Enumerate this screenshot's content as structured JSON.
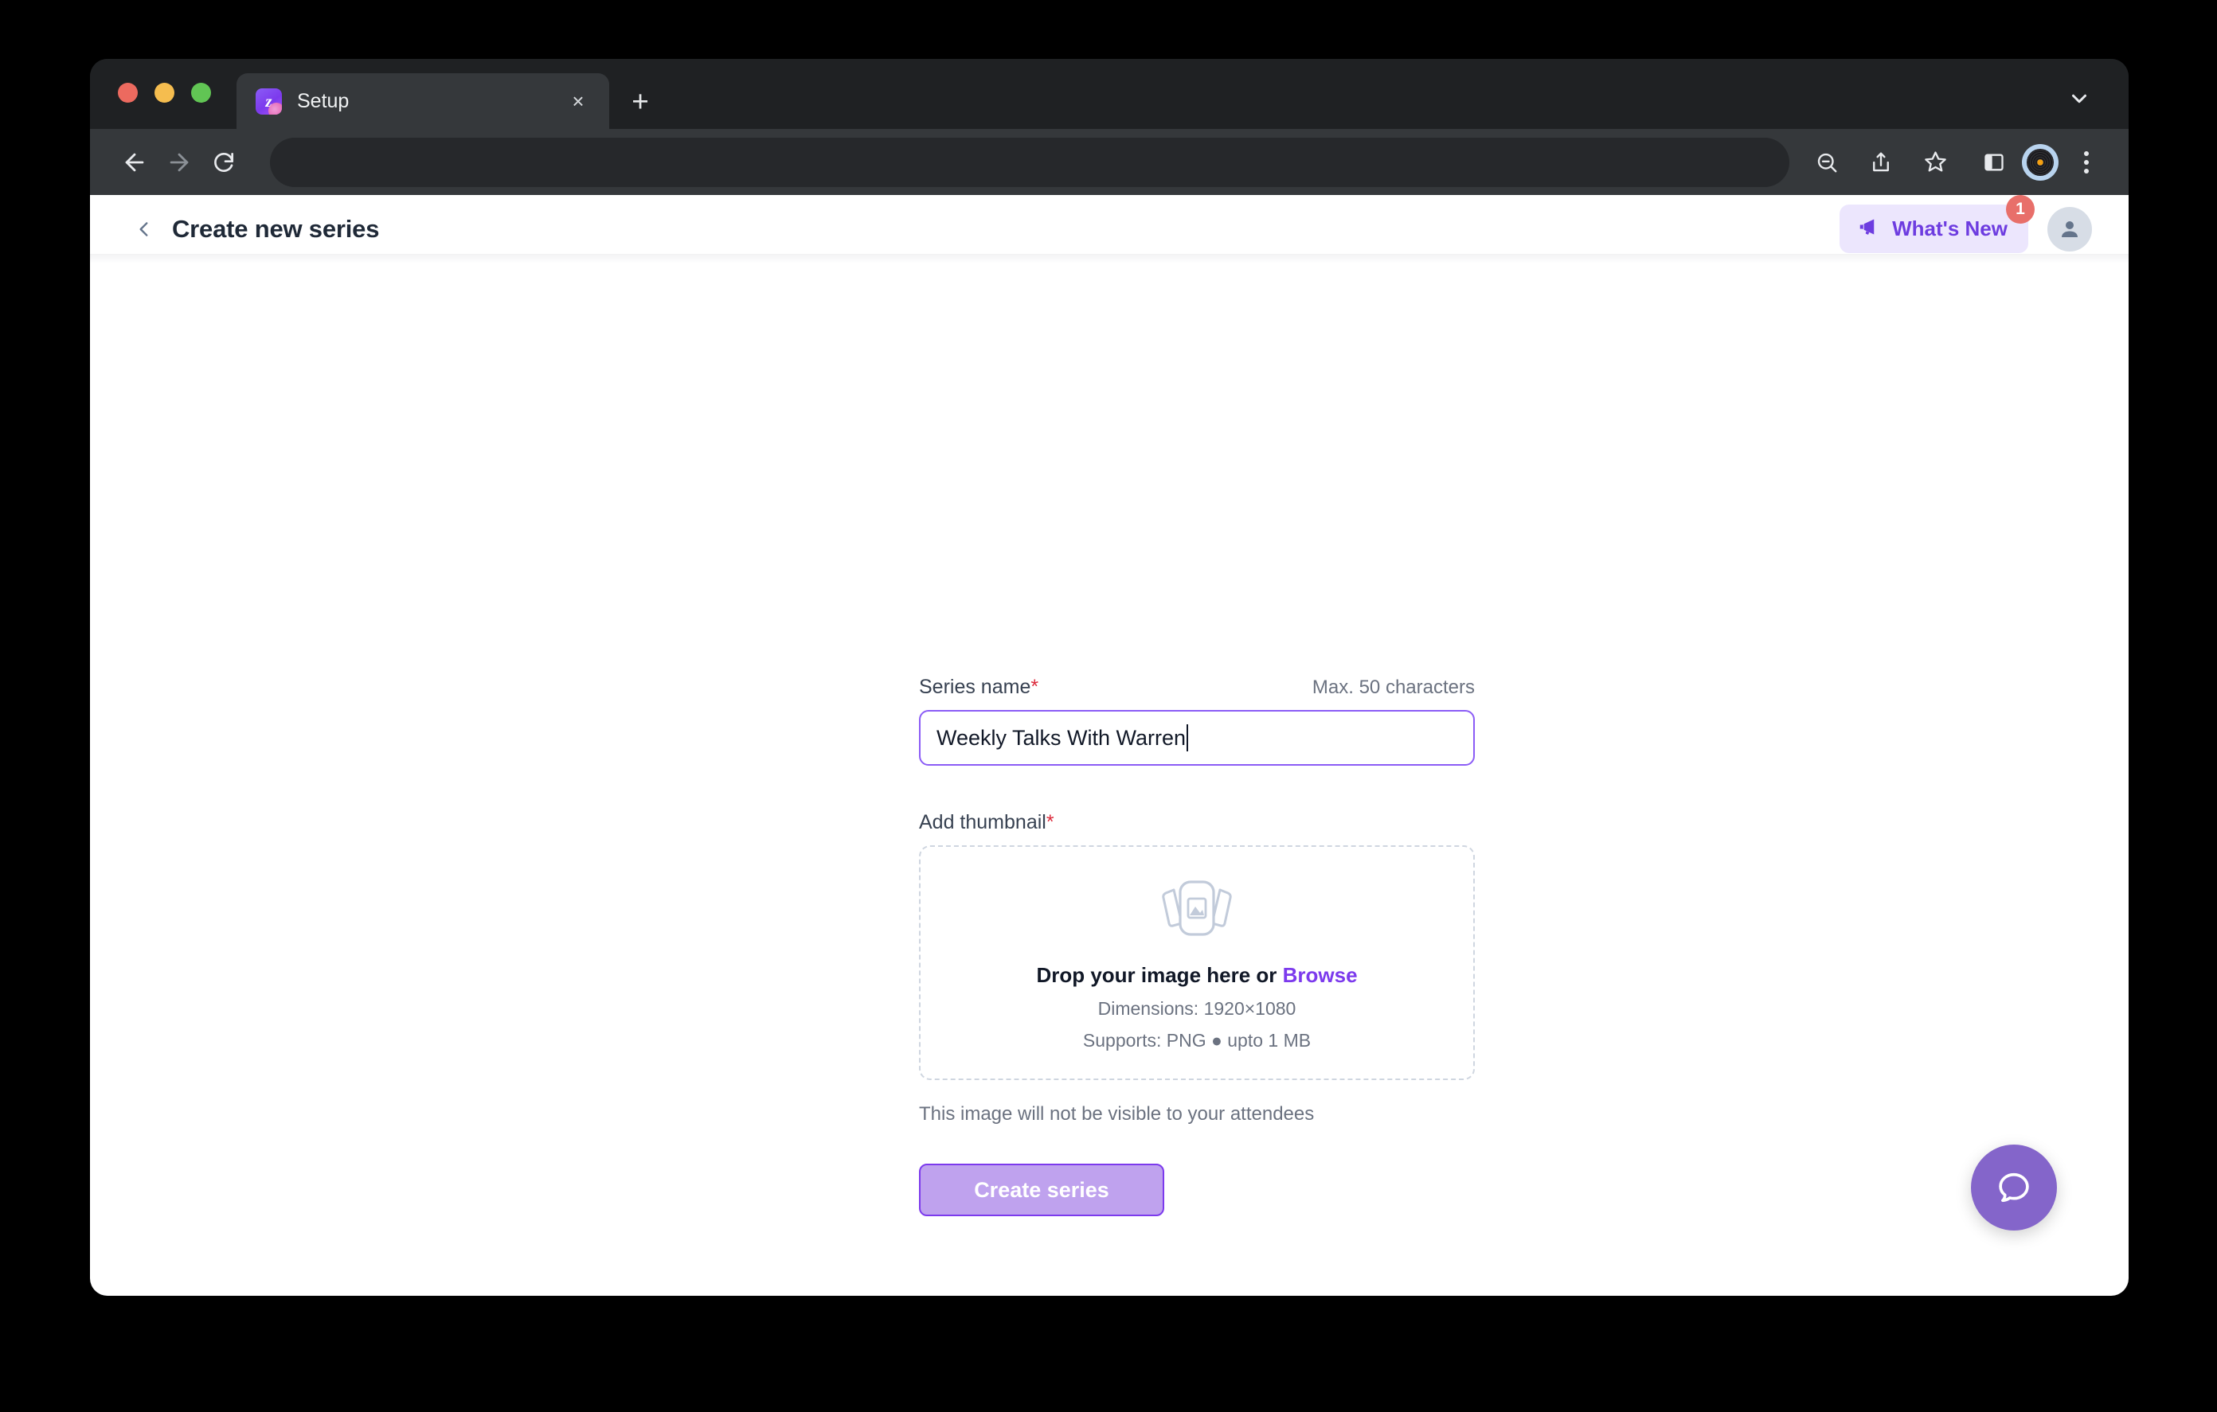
{
  "browser": {
    "traffic_lights": [
      {
        "name": "close",
        "color": "#ec6a5f"
      },
      {
        "name": "minimize",
        "color": "#f5bd4f"
      },
      {
        "name": "maximize",
        "color": "#61c554"
      }
    ],
    "tab": {
      "title": "Setup",
      "favicon_glyph": "z",
      "favicon_name": "zoom-app-favicon",
      "close_glyph": "×"
    },
    "new_tab_glyph": "+",
    "address_bar_value": "",
    "address_bar_placeholder": "",
    "toolbar_icons": [
      "zoom-out-icon",
      "share-icon",
      "bookmark-star-icon",
      "sidebar-toggle-icon",
      "profile-avatar-icon",
      "browser-menu-icon"
    ]
  },
  "header": {
    "title": "Create new series",
    "back_icon": "chevron-left-icon",
    "whats_new": {
      "label": "What's New",
      "icon": "megaphone-icon",
      "badge": "1",
      "badge_color": "#e86f6a",
      "accent_color": "#6d3ce0",
      "background_color": "#ece6fd"
    },
    "avatar_icon": "user-avatar-icon"
  },
  "form": {
    "series_name": {
      "label": "Series name",
      "required_marker": "*",
      "max_chars_hint": "Max. 50 characters",
      "value": "Weekly Talks With Warren",
      "placeholder": "Enter series name",
      "focused": true,
      "focus_border_color": "#8b5cf6"
    },
    "thumbnail": {
      "label": "Add thumbnail",
      "required_marker": "*",
      "placeholder_icon": "image-stack-icon",
      "drop_text_prefix": "Drop your image here or ",
      "browse_label": "Browse",
      "dimensions_text": "Dimensions: 1920×1080",
      "supports_text": "Supports: PNG ● upto 1 MB",
      "helper_text": "This image will not be visible to your attendees"
    },
    "submit": {
      "label": "Create series",
      "fill_color": "#bfa2ee",
      "border_color": "#7c3aed",
      "disabled": true
    }
  },
  "help": {
    "fab_icon": "chat-bubble-icon",
    "fab_color": "#8465ca"
  }
}
